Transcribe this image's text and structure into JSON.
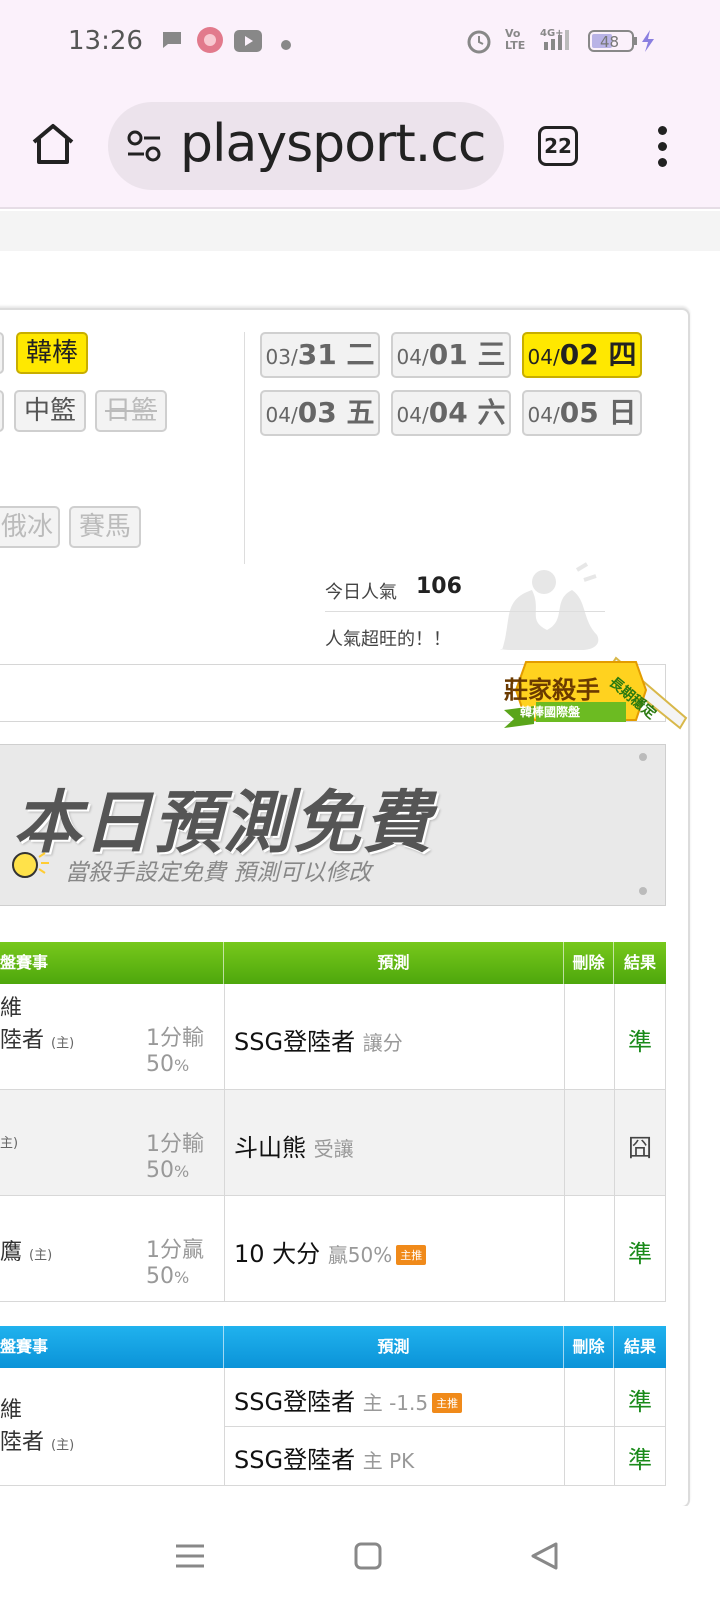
{
  "status": {
    "time": "13:26",
    "battery": "48"
  },
  "browser": {
    "url": "playsport.cc",
    "tab_count": "22"
  },
  "sports": {
    "row1": [
      "韓棒"
    ],
    "row2": [
      "中籃",
      "日籃"
    ],
    "row3": [
      "俄冰",
      "賽馬"
    ]
  },
  "dates": [
    {
      "md": "03/",
      "d": "31 二",
      "selected": false
    },
    {
      "md": "04/",
      "d": "01 三",
      "selected": false
    },
    {
      "md": "04/",
      "d": "02 四",
      "selected": true
    },
    {
      "md": "04/",
      "d": "03 五",
      "selected": false
    },
    {
      "md": "04/",
      "d": "04 六",
      "selected": false
    },
    {
      "md": "04/",
      "d": "05 日",
      "selected": false
    }
  ],
  "popularity": {
    "label": "今日人氣",
    "value": "106",
    "text": "人氣超旺的！！"
  },
  "badge": {
    "title": "莊家殺手",
    "sub": "韓棒國際盤",
    "ribbon": "長期穩定"
  },
  "banner": {
    "title": "本日預測免費",
    "subtitle": "當殺手設定免費  預測可以修改"
  },
  "table1": {
    "headers": {
      "match": "盤賽事",
      "prediction": "預測",
      "delete": "刪除",
      "result": "結果"
    },
    "rows": [
      {
        "team1": "維",
        "team2": "陸者",
        "home": "(主)",
        "outcome": "1分輸",
        "pct": "50",
        "pct_unit": "%",
        "pick": "SSG登陸者",
        "pick_sub": "讓分",
        "tag": "",
        "result": "準"
      },
      {
        "team1": "",
        "team2": "",
        "home": "主)",
        "outcome": "1分輸",
        "pct": "50",
        "pct_unit": "%",
        "pick": "斗山熊",
        "pick_sub": "受讓",
        "tag": "",
        "result": "囧"
      },
      {
        "team1": "",
        "team2": "鷹",
        "home": "(主)",
        "outcome": "1分贏",
        "pct": "50",
        "pct_unit": "%",
        "pick": "10 大分",
        "pick_sub": "贏50%",
        "tag": "主推",
        "result": "準"
      }
    ]
  },
  "table2": {
    "headers": {
      "match": "盤賽事",
      "prediction": "預測",
      "delete": "刪除",
      "result": "結果"
    },
    "team1": "維",
    "team2": "陸者",
    "home": "(主)",
    "rows": [
      {
        "pick": "SSG登陸者",
        "pick_sub": "主 -1.5",
        "tag": "主推",
        "result": "準"
      },
      {
        "pick": "SSG登陸者",
        "pick_sub": "主 PK",
        "tag": "",
        "result": "準"
      }
    ]
  }
}
